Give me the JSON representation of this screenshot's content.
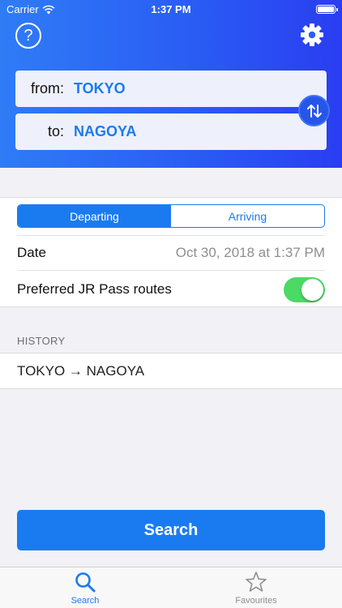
{
  "status_bar": {
    "carrier": "Carrier",
    "time": "1:37 PM"
  },
  "header": {
    "help_label": "?",
    "from": {
      "label": "from:",
      "value": "TOKYO"
    },
    "to": {
      "label": "to:",
      "value": "NAGOYA"
    }
  },
  "segment": {
    "options": [
      "Departing",
      "Arriving"
    ],
    "selected": "Departing"
  },
  "date": {
    "label": "Date",
    "value": "Oct 30, 2018 at 1:37 PM"
  },
  "jr_pass": {
    "label": "Preferred JR Pass routes",
    "enabled": true
  },
  "history": {
    "heading": "HISTORY",
    "items": [
      "TOKYO → NAGOYA"
    ]
  },
  "search_button": {
    "label": "Search"
  },
  "tabbar": {
    "items": [
      {
        "label": "Search",
        "icon": "magnifier-icon",
        "active": true
      },
      {
        "label": "Favourites",
        "icon": "star-icon",
        "active": false
      }
    ]
  },
  "colors": {
    "accent": "#1a7bf0",
    "toggle_on": "#4cd964",
    "header_start": "#2f7cf6",
    "header_end": "#2a3df2"
  }
}
